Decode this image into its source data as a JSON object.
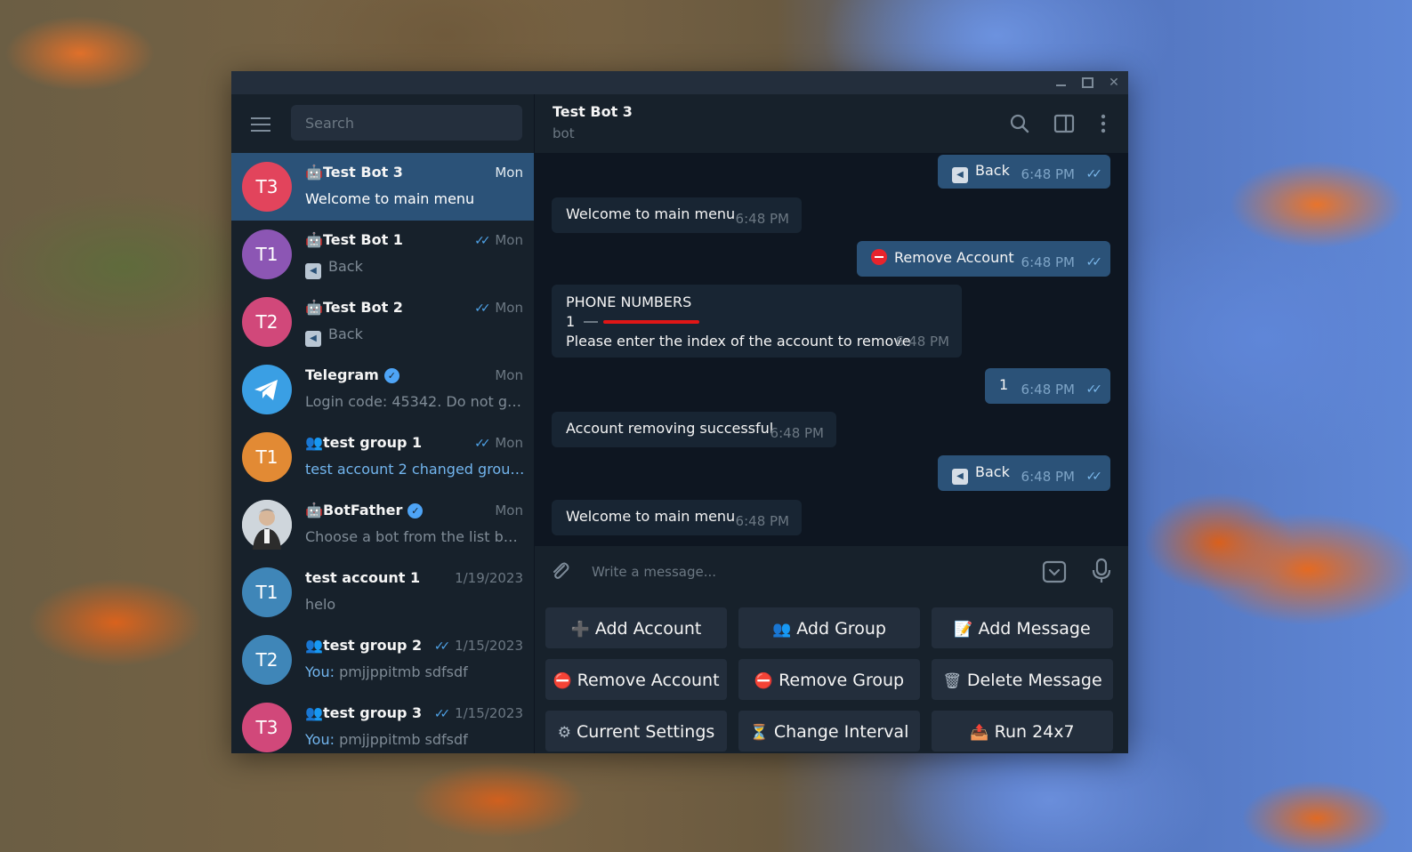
{
  "window": {
    "min_label": "",
    "max_label": "",
    "close_label": "✕"
  },
  "sidebar": {
    "search_placeholder": "Search",
    "chats": [
      {
        "initials": "T3",
        "color": "#e2445c",
        "icon": "bot",
        "name": "Test Bot 3",
        "time": "Mon",
        "ticks": "",
        "preview": "Welcome to main menu",
        "active": true
      },
      {
        "initials": "T1",
        "color": "#8c56b4",
        "icon": "bot",
        "name": "Test Bot 1",
        "time": "Mon",
        "ticks": "✓✓",
        "preview": "Back"
      },
      {
        "initials": "T2",
        "color": "#d1487a",
        "icon": "bot",
        "name": "Test Bot 2",
        "time": "Mon",
        "ticks": "✓✓",
        "preview": "Back"
      },
      {
        "initials": "",
        "color": "#3a9fe4",
        "icon": "",
        "name": "Telegram",
        "time": "Mon",
        "ticks": "",
        "preview": "Login code: 45342. Do not give ..."
      },
      {
        "initials": "T1",
        "color": "#e28a34",
        "icon": "group",
        "name": "test group 1",
        "time": "Mon",
        "ticks": "✓✓",
        "preview": "test account 2 changed group ..."
      },
      {
        "initials": "",
        "color": "#c9c9c9",
        "icon": "bot",
        "name": "BotFather",
        "time": "Mon",
        "ticks": "",
        "preview": "Choose a bot from the list below:"
      },
      {
        "initials": "T1",
        "color": "#3f86b8",
        "icon": "",
        "name": "test account 1",
        "time": "1/19/2023",
        "ticks": "",
        "preview": "helo"
      },
      {
        "initials": "T2",
        "color": "#3f86b8",
        "icon": "group",
        "name": "test group 2",
        "time": "1/15/2023",
        "ticks": "✓✓",
        "preview_prefix": "You:",
        "preview": "pmjjppitmb sdfsdf"
      },
      {
        "initials": "T3",
        "color": "#d1487a",
        "icon": "group",
        "name": "test group 3",
        "time": "1/15/2023",
        "ticks": "✓✓",
        "preview_prefix": "You:",
        "preview": "pmjjppitmb sdfsdf"
      }
    ]
  },
  "chat": {
    "title": "Test Bot 3",
    "status": "bot",
    "messages": [
      {
        "dir": "out",
        "text": "Back",
        "time": "6:48 PM"
      },
      {
        "dir": "in",
        "text": "Welcome to main menu",
        "time": "6:48 PM"
      },
      {
        "dir": "out",
        "text": "Remove Account",
        "time": "6:48 PM"
      },
      {
        "dir": "in",
        "line1": "PHONE NUMBERS",
        "line2_index": "1",
        "line3": "Please enter the index of the account to remove",
        "time": "6:48 PM"
      },
      {
        "dir": "out",
        "text": "1",
        "time": "6:48 PM"
      },
      {
        "dir": "in",
        "text": "Account removing successful",
        "time": "6:48 PM"
      },
      {
        "dir": "out",
        "text": "Back",
        "time": "6:48 PM"
      },
      {
        "dir": "in",
        "text": "Welcome to main menu",
        "time": "6:48 PM"
      }
    ],
    "composer_placeholder": "Write a message..."
  },
  "keyboard": [
    {
      "emoji": "➕",
      "label": "Add Account"
    },
    {
      "emoji": "👥",
      "label": "Add Group"
    },
    {
      "emoji": "📝",
      "label": "Add Message"
    },
    {
      "emoji": "⛔",
      "label": "Remove Account"
    },
    {
      "emoji": "⛔",
      "label": "Remove Group"
    },
    {
      "emoji": "🗑",
      "label": "Delete Message"
    },
    {
      "emoji": "⚙",
      "label": "Current Settings"
    },
    {
      "emoji": "⏳",
      "label": "Change Interval"
    },
    {
      "emoji": "📤",
      "label": "Run 24x7"
    }
  ]
}
